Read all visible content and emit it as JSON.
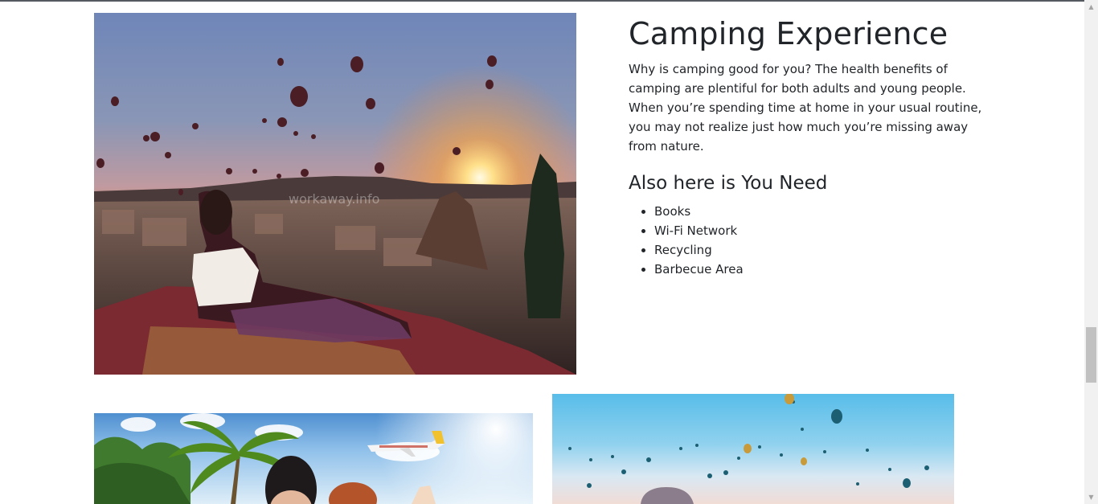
{
  "camping": {
    "title": "Camping Experience",
    "description": "Why is camping good for you? The health benefits of camping are plentiful for both adults and young people. When you’re spending time at home in your usual routine, you may not realize just how much you’re missing away from nature.",
    "subtitle": "Also here is You Need",
    "amenities": [
      "Books",
      "Wi-Fi Network",
      "Recycling",
      "Barbecue Area"
    ]
  },
  "hero_image": {
    "watermark": "workaway.info",
    "subject": "hot-air-balloons-sunset"
  },
  "icons": {
    "scroll_up": "▲",
    "scroll_down": "▼"
  },
  "colors": {
    "text": "#212529",
    "top_rule": "#555a60",
    "scrollbar_track": "#f1f1f1",
    "scrollbar_thumb": "#c1c1c1"
  }
}
